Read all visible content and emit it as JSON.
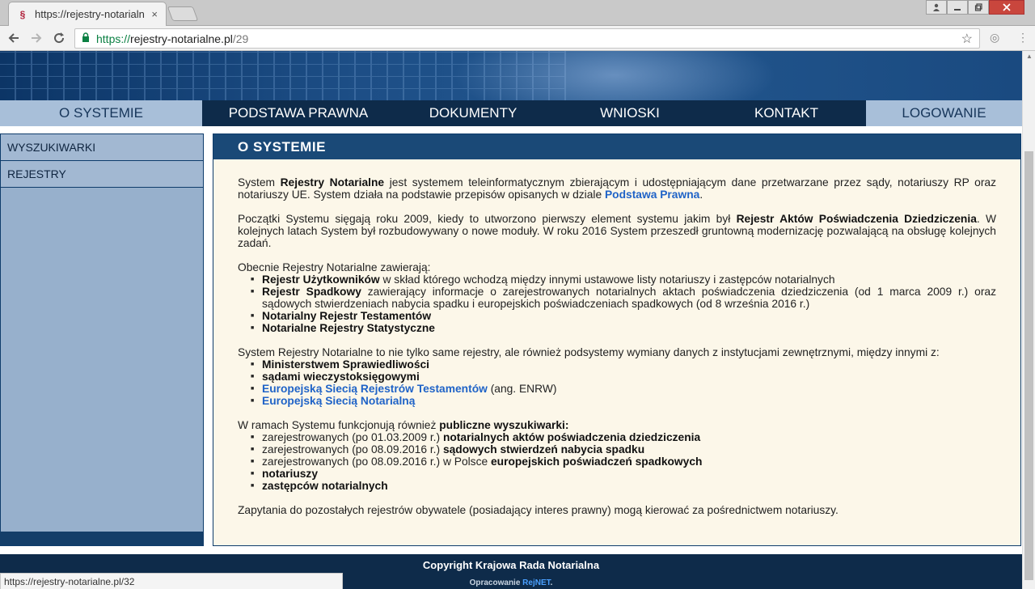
{
  "browser": {
    "tab_title": "https://rejestry-notarialn",
    "tab_close": "×",
    "url_scheme": "https://",
    "url_host": "rejestry-notarialne.pl",
    "url_path": "/29",
    "status_url": "https://rejestry-notarialne.pl/32"
  },
  "nav": {
    "items": [
      "O SYSTEMIE",
      "PODSTAWA PRAWNA",
      "DOKUMENTY",
      "WNIOSKI",
      "KONTAKT",
      "LOGOWANIE"
    ]
  },
  "sidebar": {
    "items": [
      "WYSZUKIWARKI",
      "REJESTRY"
    ]
  },
  "content": {
    "title": "O  SYSTEMIE",
    "p1": {
      "a": "System ",
      "b": "Rejestry Notarialne",
      "c": " jest systemem teleinformatycznym zbierającym i udostępniającym dane przetwarzane przez sądy, notariuszy RP oraz notariuszy UE. System działa na podstawie przepisów opisanych w dziale ",
      "link": "Podstawa Prawna",
      "d": "."
    },
    "p2": {
      "a": "Początki Systemu sięgają roku 2009, kiedy to utworzono pierwszy element systemu jakim był ",
      "b": "Rejestr Aktów Poświadczenia Dziedziczenia",
      "c": ". W kolejnych latach System był rozbudowywany o nowe moduły. W roku 2016 System przeszedł gruntowną modernizację pozwalającą na obsługę kolejnych zadań."
    },
    "p3_intro": "Obecnie Rejestry Notarialne zawierają:",
    "list1": [
      {
        "b": "Rejestr Użytkowników",
        "t": " w skład którego wchodzą między innymi ustawowe listy notariuszy i zastępców notarialnych"
      },
      {
        "b": "Rejestr Spadkowy",
        "t": " zawierający informacje o zarejestrowanych notarialnych aktach poświadczenia dziedziczenia (od 1 marca 2009 r.) oraz sądowych stwierdzeniach nabycia spadku i europejskich poświadczeniach spadkowych (od 8 września 2016 r.)"
      },
      {
        "b": "Notarialny Rejestr Testamentów",
        "t": ""
      },
      {
        "b": "Notarialne Rejestry Statystyczne",
        "t": ""
      }
    ],
    "p4_intro": "System Rejestry Notarialne to nie tylko same rejestry, ale również podsystemy wymiany danych z instytucjami zewnętrznymi, między innymi z:",
    "list2": {
      "i1": "Ministerstwem Sprawiedliwości",
      "i2": "sądami wieczystoksięgowymi",
      "i3_link": "Europejską Siecią Rejestrów Testamentów",
      "i3_rest": " (ang. ENRW)",
      "i4_link": "Europejską Siecią Notarialną"
    },
    "p5": {
      "a": "W ramach Systemu funkcjonują również ",
      "b": "publiczne wyszukiwarki:"
    },
    "list3": [
      {
        "t": "zarejestrowanych (po 01.03.2009 r.) ",
        "b": "notarialnych aktów poświadczenia dziedziczenia"
      },
      {
        "t": "zarejestrowanych (po 08.09.2016 r.) ",
        "b": "sądowych stwierdzeń nabycia spadku"
      },
      {
        "t": "zarejestrowanych (po 08.09.2016 r.) w Polsce ",
        "b": "europejskich poświadczeń spadkowych"
      },
      {
        "t": "",
        "b": "notariuszy"
      },
      {
        "t": "",
        "b": "zastępców notarialnych"
      }
    ],
    "p6": "Zapytania do pozostałych rejestrów obywatele (posiadający interes prawny) mogą kierować za pośrednictwem notariuszy."
  },
  "footer": {
    "copyright": "Copyright Krajowa Rada Notarialna",
    "made_prefix": "Opracowanie ",
    "made_link": "RejNET",
    "made_suffix": "."
  }
}
